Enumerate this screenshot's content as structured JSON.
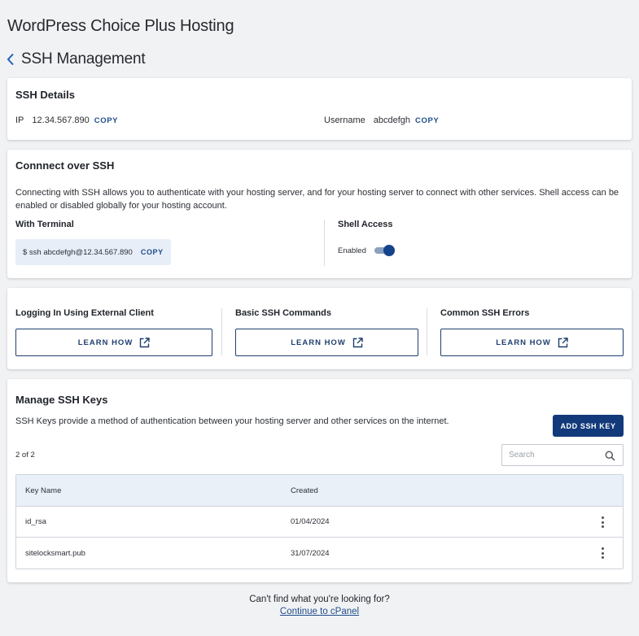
{
  "header": {
    "title": "WordPress Choice Plus Hosting",
    "back_icon": "chevron-left-icon",
    "subtitle": "SSH Management"
  },
  "ssh_details": {
    "title": "SSH Details",
    "ip_label": "IP",
    "ip_value": "12.34.567.890",
    "ip_copy": "COPY",
    "username_label": "Username",
    "username_value": "abcdefgh",
    "username_copy": "COPY"
  },
  "connect": {
    "title": "Connnect over SSH",
    "description": "Connecting with SSH allows you to authenticate with your hosting server, and for your hosting server to connect with other services. Shell access can be enabled or disabled globally for your hosting account.",
    "terminal_label": "With Terminal",
    "command": "$ ssh abcdefgh@12.34.567.890",
    "command_copy": "COPY",
    "shell_label": "Shell Access",
    "shell_status": "Enabled",
    "shell_enabled": true
  },
  "help": {
    "items": [
      {
        "title": "Logging In Using External Client",
        "button": "LEARN HOW",
        "icon": "external-link-icon"
      },
      {
        "title": "Basic SSH Commands",
        "button": "LEARN HOW",
        "icon": "external-link-icon"
      },
      {
        "title": "Common SSH Errors",
        "button": "LEARN HOW",
        "icon": "external-link-icon"
      }
    ]
  },
  "keys": {
    "title": "Manage SSH Keys",
    "description": "SSH Keys provide a method of authentication between your hosting server and other services on the internet.",
    "add_button": "ADD SSH KEY",
    "count": "2 of 2",
    "search_placeholder": "Search",
    "search_icon": "search-icon",
    "columns": [
      "Key Name",
      "Created"
    ],
    "rows": [
      {
        "name": "id_rsa",
        "created": "01/04/2024"
      },
      {
        "name": "sitelocksmart.pub",
        "created": "31/07/2024"
      }
    ],
    "row_menu_icon": "kebab-menu-icon"
  },
  "footer": {
    "question": "Can't find what you're looking for?",
    "link": "Continue to cPanel"
  },
  "colors": {
    "accent": "#123a7a",
    "link": "#1f4d8c",
    "background": "#f1f2f4",
    "command_bg": "#e7eef8",
    "table_header_bg": "#eaf0f8"
  }
}
